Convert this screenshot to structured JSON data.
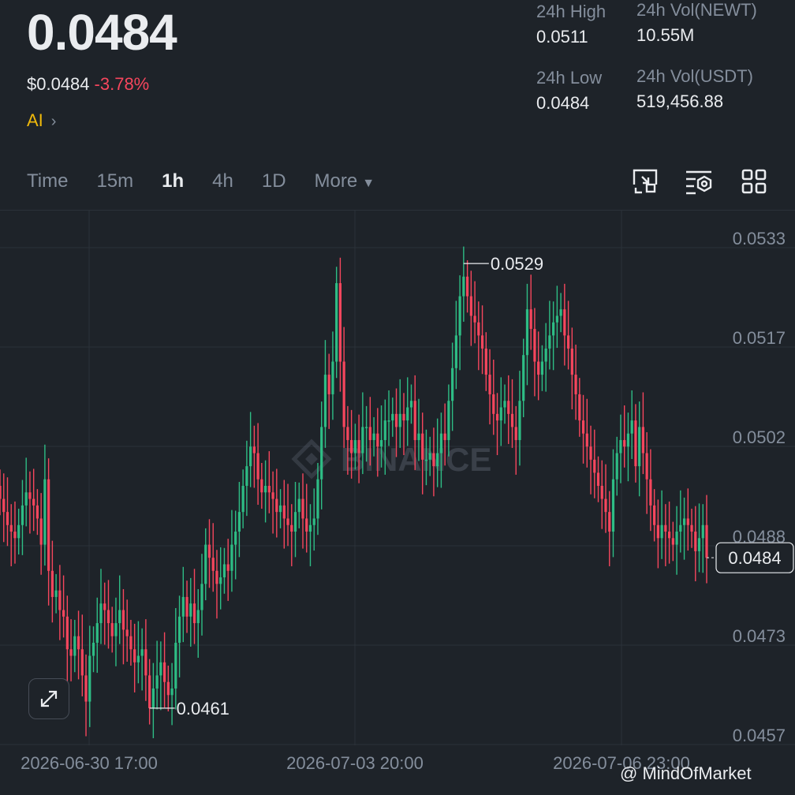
{
  "ticker": {
    "price": "0.0484",
    "usd_price": "$0.0484",
    "change_pct": "-3.78%",
    "tag": "AI",
    "high_label": "24h High",
    "high_value": "0.0511",
    "low_label": "24h Low",
    "low_value": "0.0484",
    "vol_base_label": "24h Vol(NEWT)",
    "vol_base_value": "10.55M",
    "vol_quote_label": "24h Vol(USDT)",
    "vol_quote_value": "519,456.88"
  },
  "tabs": [
    {
      "label": "Time"
    },
    {
      "label": "15m"
    },
    {
      "label": "1h"
    },
    {
      "label": "4h"
    },
    {
      "label": "1D"
    },
    {
      "label": "More"
    }
  ],
  "active_tab": "1h",
  "toolbar_icons": [
    "fullscreen-chart-icon",
    "indicator-settings-icon",
    "grid-layout-icon"
  ],
  "watermark": "BINANCE",
  "footer_watermark": "@ MindOfMarket",
  "colors": {
    "up": "#2ebd85",
    "down": "#f6465d",
    "accent": "#f0b90b",
    "bg": "#1e2329"
  },
  "chart_data": {
    "type": "candlestick",
    "interval": "1h",
    "y_ticks": [
      "0.0533",
      "0.0517",
      "0.0502",
      "0.0488",
      "0.0473",
      "0.0457"
    ],
    "x_ticks": [
      "2026-06-30 17:00",
      "2026-07-03 20:00",
      "2026-07-06 23:00"
    ],
    "ylim": [
      0.0455,
      0.0536
    ],
    "annotations": {
      "high": "0.0529",
      "low": "0.0461",
      "last_price": "0.0484"
    },
    "closes": [
      0.0493,
      0.0491,
      0.0489,
      0.0488,
      0.0487,
      0.0489,
      0.0492,
      0.0494,
      0.0493,
      0.0492,
      0.049,
      0.0486,
      0.0496,
      0.0482,
      0.0478,
      0.0479,
      0.0476,
      0.0475,
      0.047,
      0.0469,
      0.0472,
      0.047,
      0.0466,
      0.0462,
      0.0469,
      0.0471,
      0.0474,
      0.0477,
      0.0476,
      0.0474,
      0.0472,
      0.0474,
      0.0476,
      0.0473,
      0.0472,
      0.047,
      0.0468,
      0.0469,
      0.047,
      0.0466,
      0.0461,
      0.0464,
      0.0466,
      0.0468,
      0.0465,
      0.0463,
      0.0464,
      0.0471,
      0.0475,
      0.0478,
      0.0475,
      0.0477,
      0.0474,
      0.0476,
      0.048,
      0.0486,
      0.0484,
      0.0482,
      0.048,
      0.0481,
      0.0483,
      0.0482,
      0.0486,
      0.0488,
      0.0491,
      0.0495,
      0.0498,
      0.0501,
      0.05,
      0.0496,
      0.0494,
      0.0495,
      0.0494,
      0.0493,
      0.0491,
      0.0492,
      0.049,
      0.0489,
      0.0488,
      0.0491,
      0.0493,
      0.049,
      0.0488,
      0.0489,
      0.049,
      0.0496,
      0.0504,
      0.0512,
      0.0509,
      0.0514,
      0.0526,
      0.0514,
      0.0504,
      0.0502,
      0.05,
      0.0502,
      0.05,
      0.0504,
      0.0504,
      0.0502,
      0.0503,
      0.0501,
      0.0502,
      0.0505,
      0.0505,
      0.0506,
      0.0504,
      0.0506,
      0.0505,
      0.0507,
      0.0508,
      0.0502,
      0.0503,
      0.0499,
      0.0499,
      0.05,
      0.0498,
      0.05,
      0.0503,
      0.0502,
      0.0508,
      0.0513,
      0.0518,
      0.0524,
      0.0527,
      0.0524,
      0.0521,
      0.052,
      0.0518,
      0.0516,
      0.0512,
      0.0509,
      0.0506,
      0.0505,
      0.0507,
      0.0508,
      0.0506,
      0.0504,
      0.0502,
      0.0508,
      0.0515,
      0.0522,
      0.0519,
      0.0514,
      0.0512,
      0.0514,
      0.0516,
      0.0518,
      0.052,
      0.0521,
      0.0522,
      0.0518,
      0.0516,
      0.0512,
      0.0509,
      0.0505,
      0.0503,
      0.0501,
      0.0499,
      0.0497,
      0.0495,
      0.0493,
      0.0491,
      0.0488,
      0.0496,
      0.05,
      0.0502,
      0.0501,
      0.0503,
      0.0505,
      0.0498,
      0.0504,
      0.05,
      0.0496,
      0.0492,
      0.0489,
      0.0487,
      0.0489,
      0.0488,
      0.0487,
      0.0486,
      0.0488,
      0.0489,
      0.049,
      0.0489,
      0.0488,
      0.0485,
      0.0487,
      0.0489,
      0.0484
    ]
  }
}
